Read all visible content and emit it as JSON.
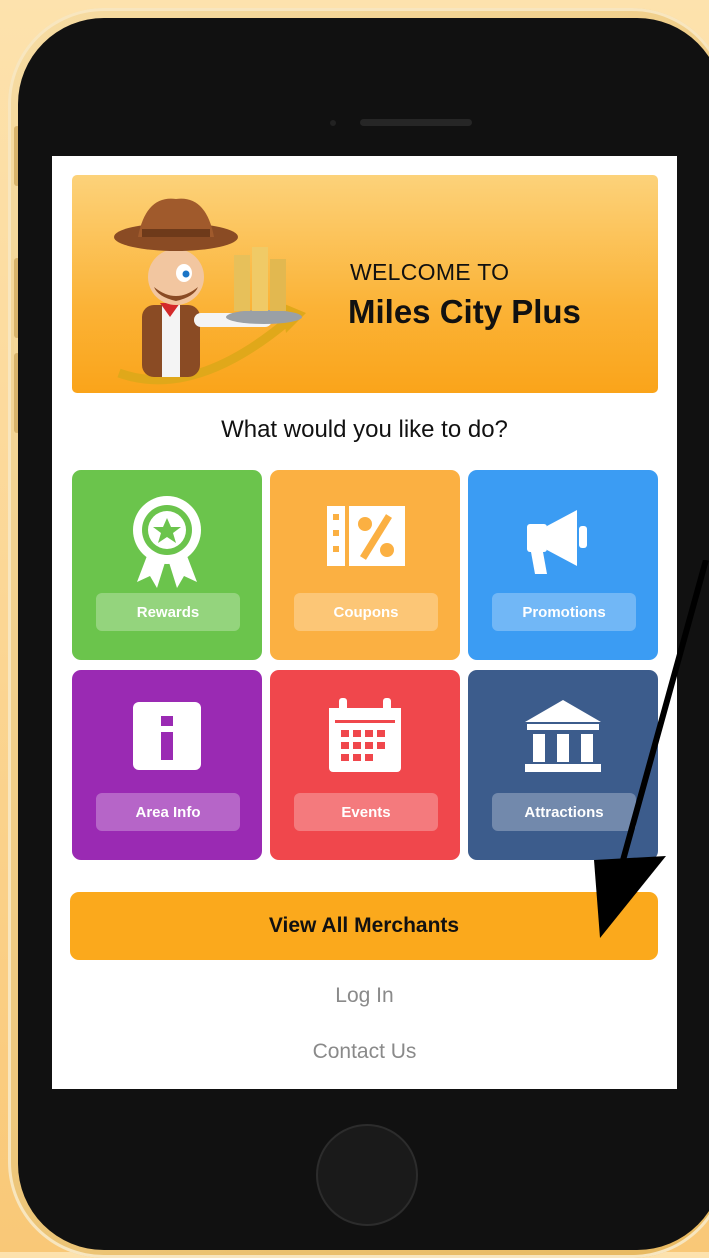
{
  "banner": {
    "welcome_line": "WELCOME TO",
    "app_name": "Miles City Plus"
  },
  "prompt": "What would you like to do?",
  "tiles": [
    {
      "label": "Rewards",
      "icon": "ribbon-badge-icon",
      "color": "#6bc44c"
    },
    {
      "label": "Coupons",
      "icon": "coupon-percent-icon",
      "color": "#fbb042"
    },
    {
      "label": "Promotions",
      "icon": "megaphone-icon",
      "color": "#3b9cf3"
    },
    {
      "label": "Area Info",
      "icon": "info-icon",
      "color": "#9a2ab3"
    },
    {
      "label": "Events",
      "icon": "calendar-icon",
      "color": "#f0474c"
    },
    {
      "label": "Attractions",
      "icon": "museum-building-icon",
      "color": "#3c5c8c"
    }
  ],
  "actions": {
    "view_all_merchants": "View All Merchants",
    "log_in": "Log In",
    "contact_us": "Contact Us"
  },
  "colors": {
    "accent": "#fba91c",
    "screen_background": "#ffffff",
    "link_text": "#8a8a8a"
  }
}
